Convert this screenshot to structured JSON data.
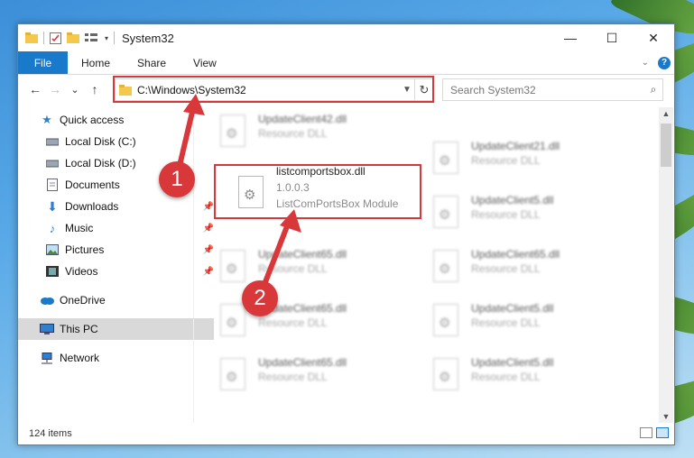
{
  "window": {
    "title": "System32",
    "controls": {
      "minimize": "—",
      "maximize": "☐",
      "close": "✕"
    }
  },
  "ribbon": {
    "tabs": [
      "File",
      "Home",
      "Share",
      "View"
    ],
    "help": "?"
  },
  "navbar": {
    "back": "←",
    "forward": "→",
    "recent": "⌄",
    "up": "↑",
    "address": "C:\\Windows\\System32",
    "search_placeholder": "Search System32"
  },
  "sidebar": {
    "items": [
      {
        "label": "Quick access",
        "icon": "star-icon"
      },
      {
        "label": "Local Disk (C:)",
        "icon": "drive-icon"
      },
      {
        "label": "Local Disk (D:)",
        "icon": "drive-icon"
      },
      {
        "label": "Documents",
        "icon": "documents-icon"
      },
      {
        "label": "Downloads",
        "icon": "download-icon",
        "pinned": true
      },
      {
        "label": "Music",
        "icon": "music-icon",
        "pinned": true
      },
      {
        "label": "Pictures",
        "icon": "pictures-icon",
        "pinned": true
      },
      {
        "label": "Videos",
        "icon": "videos-icon",
        "pinned": true
      },
      {
        "label": "OneDrive",
        "icon": "cloud-icon"
      },
      {
        "label": "This PC",
        "icon": "computer-icon",
        "selected": true
      },
      {
        "label": "Network",
        "icon": "network-icon"
      }
    ]
  },
  "files": {
    "highlighted": {
      "name": "listcomportsbox.dll",
      "version": "1.0.0.3",
      "description": "ListComPortsBox Module"
    },
    "left": [
      {
        "name": "UpdateClient42.dll",
        "type": "Resource DLL"
      },
      {
        "name": "UpdateClient65.dll",
        "type": "Resource DLL"
      },
      {
        "name": "UpdateClient65.dll",
        "type": "Resource DLL"
      },
      {
        "name": "UpdateClient65.dll",
        "type": "Resource DLL"
      }
    ],
    "right": [
      {
        "name": "UpdateClient21.dll",
        "type": "Resource DLL"
      },
      {
        "name": "UpdateClient5.dll",
        "type": "Resource DLL"
      },
      {
        "name": "UpdateClient65.dll",
        "type": "Resource DLL"
      },
      {
        "name": "UpdateClient5.dll",
        "type": "Resource DLL"
      },
      {
        "name": "UpdateClient5.dll",
        "type": "Resource DLL"
      }
    ]
  },
  "status": {
    "count": "124 items"
  },
  "annotations": {
    "step1": "1",
    "step2": "2",
    "color": "#d9383a"
  }
}
